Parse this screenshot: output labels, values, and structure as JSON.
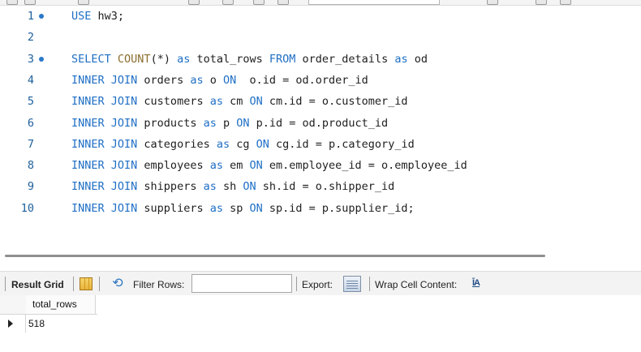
{
  "editor": {
    "lines": [
      {
        "num": "1",
        "marker": true,
        "text": "USE hw3;"
      },
      {
        "num": "2",
        "marker": false,
        "text": ""
      },
      {
        "num": "3",
        "marker": true,
        "text": "SELECT COUNT(*) as total_rows FROM order_details as od"
      },
      {
        "num": "4",
        "marker": false,
        "text": "INNER JOIN orders as o ON  o.id = od.order_id"
      },
      {
        "num": "5",
        "marker": false,
        "text": "INNER JOIN customers as cm ON cm.id = o.customer_id"
      },
      {
        "num": "6",
        "marker": false,
        "text": "INNER JOIN products as p ON p.id = od.product_id"
      },
      {
        "num": "7",
        "marker": false,
        "text": "INNER JOIN categories as cg ON cg.id = p.category_id"
      },
      {
        "num": "8",
        "marker": false,
        "text": "INNER JOIN employees as em ON em.employee_id = o.employee_id"
      },
      {
        "num": "9",
        "marker": false,
        "text": "INNER JOIN shippers as sh ON sh.id = o.shipper_id"
      },
      {
        "num": "10",
        "marker": false,
        "text": "INNER JOIN suppliers as sp ON sp.id = p.supplier_id;"
      }
    ]
  },
  "result_toolbar": {
    "result_grid_label": "Result Grid",
    "filter_rows_label": "Filter Rows:",
    "filter_value": "",
    "export_label": "Export:",
    "wrap_label": "Wrap Cell Content:",
    "wrap_icon_text": "ĪA"
  },
  "grid": {
    "columns": [
      "total_rows"
    ],
    "rows": [
      [
        "518"
      ]
    ]
  },
  "colors": {
    "keyword": "#1f6fc5",
    "function": "#8a6d2d",
    "line_number": "#1d5f9b"
  },
  "icons": [
    "grid-view-icon",
    "refresh-icon",
    "export-icon",
    "wrap-cell-icon",
    "row-pointer-icon"
  ]
}
